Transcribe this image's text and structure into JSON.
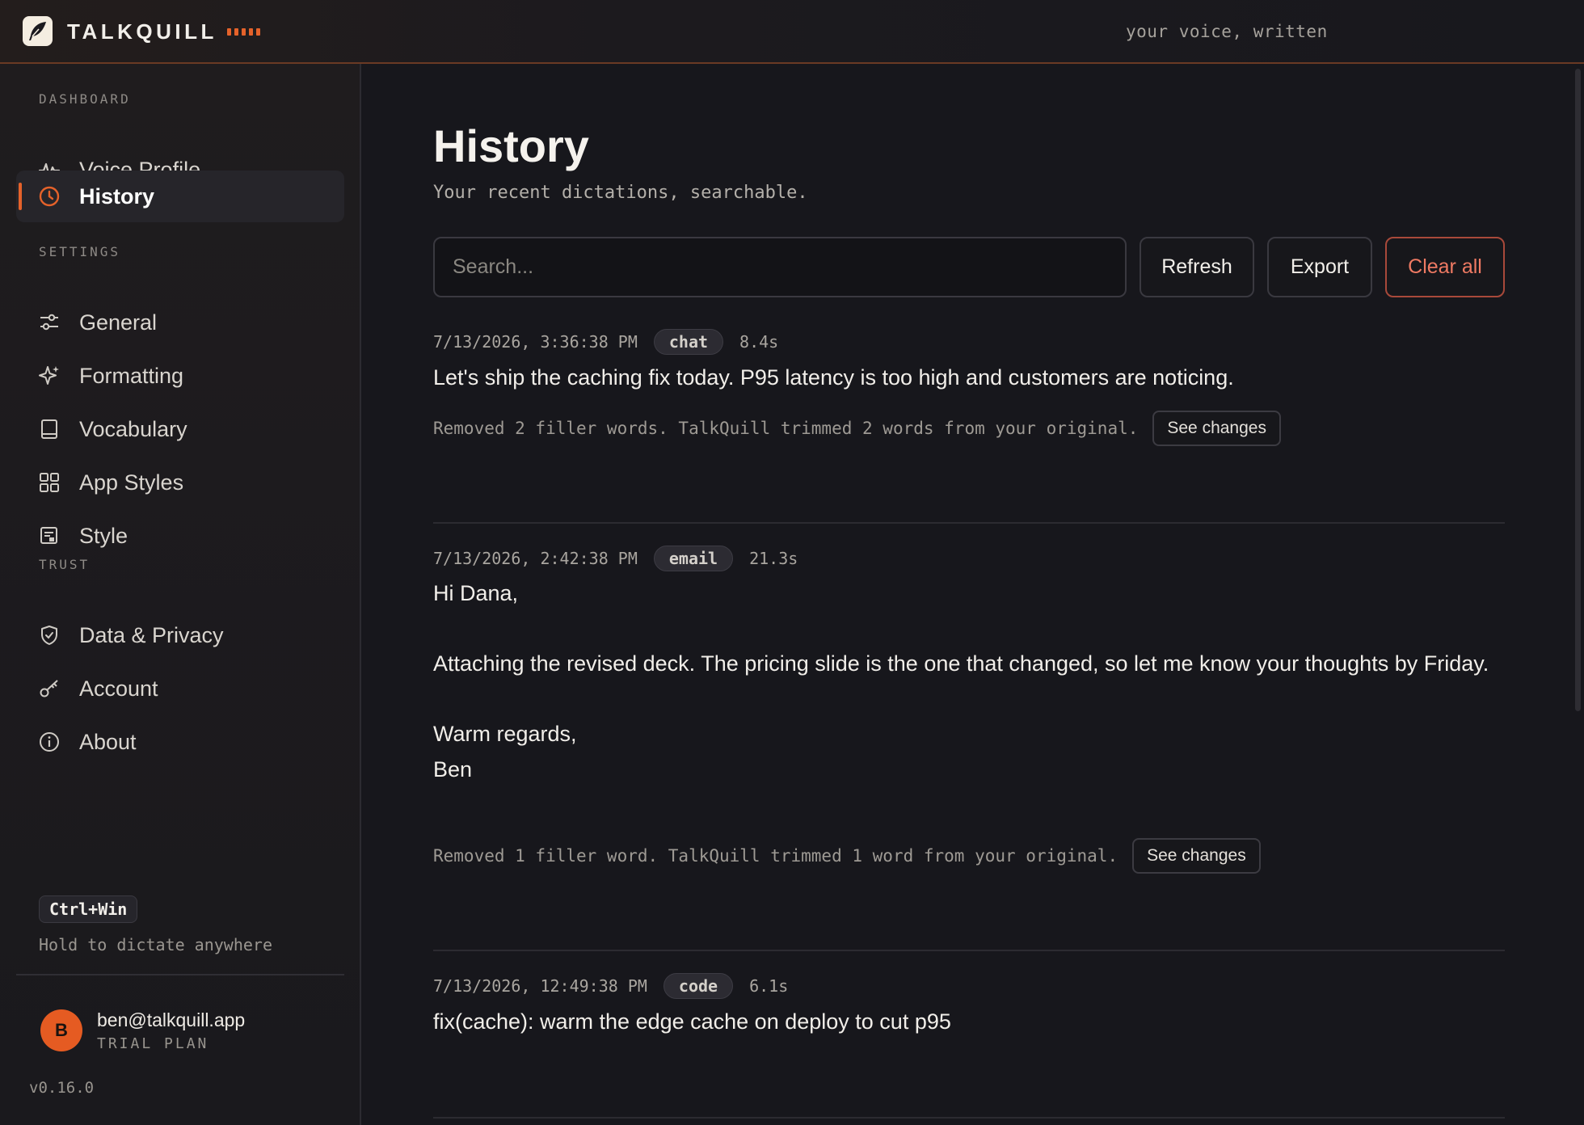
{
  "app": {
    "brand": "TALKQUILL",
    "tagline": "your voice, written"
  },
  "sidebar": {
    "sections": {
      "dashboard": "DASHBOARD",
      "settings": "SETTINGS",
      "trust": "TRUST"
    },
    "items": [
      {
        "label": "Voice Profile",
        "icon": "waveform-icon"
      },
      {
        "label": "History",
        "icon": "clock-icon",
        "active": true
      },
      {
        "label": "General",
        "icon": "sliders-icon"
      },
      {
        "label": "Formatting",
        "icon": "sparkle-icon"
      },
      {
        "label": "Vocabulary",
        "icon": "book-icon"
      },
      {
        "label": "App Styles",
        "icon": "grid-icon"
      },
      {
        "label": "Style",
        "icon": "style-icon"
      },
      {
        "label": "Data & Privacy",
        "icon": "shield-check-icon"
      },
      {
        "label": "Account",
        "icon": "key-icon"
      },
      {
        "label": "About",
        "icon": "info-icon"
      }
    ],
    "shortcut": "Ctrl+Win",
    "shortcut_hint": "Hold to dictate anywhere",
    "user": {
      "initial": "B",
      "email": "ben@talkquill.app",
      "plan": "TRIAL PLAN"
    },
    "version": "v0.16.0"
  },
  "main": {
    "title": "History",
    "subtitle": "Your recent dictations, searchable.",
    "search_placeholder": "Search...",
    "buttons": {
      "refresh": "Refresh",
      "export": "Export",
      "clear": "Clear all"
    },
    "entries": [
      {
        "time": "7/13/2026, 3:36:38 PM",
        "tag": "chat",
        "duration": "8.4s",
        "text": "Let's ship the caching fix today. P95 latency is too high and customers are noticing.",
        "note": "Removed 2 filler words. TalkQuill trimmed 2 words from your original.",
        "action": "See changes"
      },
      {
        "time": "7/13/2026, 2:42:38 PM",
        "tag": "email",
        "duration": "21.3s",
        "text": "Hi Dana,\n\nAttaching the revised deck. The pricing slide is the one that changed, so let me know your thoughts by Friday.\n\nWarm regards,\nBen",
        "note": "Removed 1 filler word. TalkQuill trimmed 1 word from your original.",
        "action": "See changes"
      },
      {
        "time": "7/13/2026, 12:49:38 PM",
        "tag": "code",
        "duration": "6.1s",
        "text": "fix(cache): warm the edge cache on deploy to cut p95"
      }
    ]
  },
  "colors": {
    "accent": "#e5622a",
    "danger": "#ef7a63",
    "background": "#17171c"
  }
}
